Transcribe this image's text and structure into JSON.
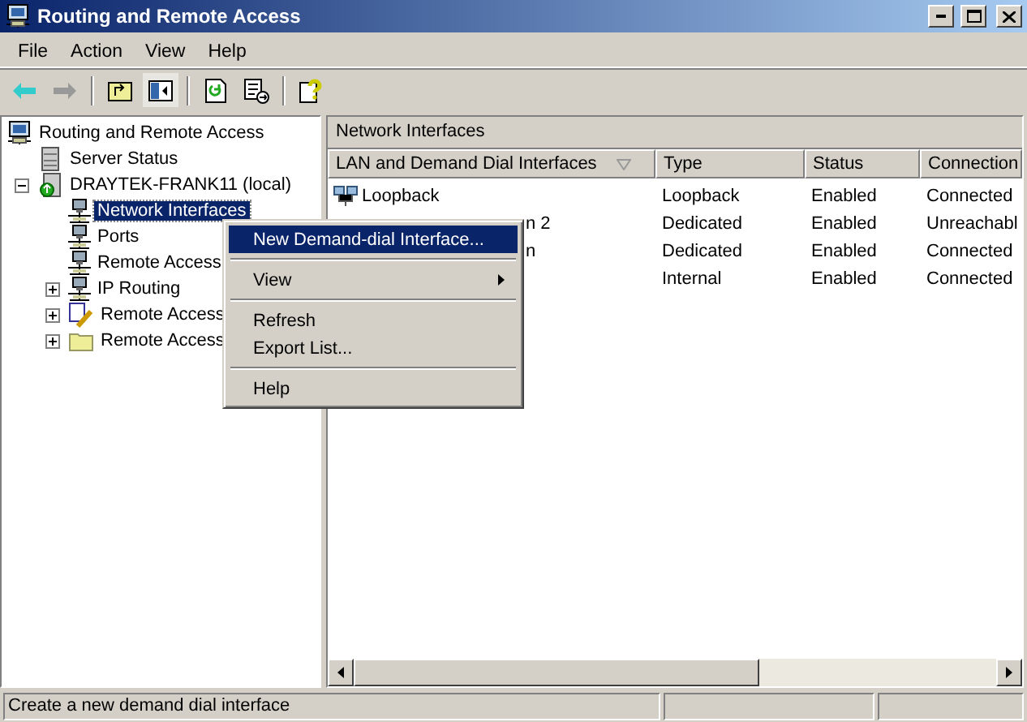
{
  "window": {
    "title": "Routing and Remote Access"
  },
  "menu_bar": [
    "File",
    "Action",
    "View",
    "Help"
  ],
  "toolbar": [
    {
      "kind": "back",
      "disabled": false
    },
    {
      "kind": "forward",
      "disabled": true
    },
    {
      "kind": "sep"
    },
    {
      "kind": "up"
    },
    {
      "kind": "tree",
      "selected": true
    },
    {
      "kind": "sep"
    },
    {
      "kind": "refresh"
    },
    {
      "kind": "export"
    },
    {
      "kind": "sep"
    },
    {
      "kind": "help"
    }
  ],
  "tree": [
    {
      "label": "Routing and Remote Access",
      "kind": "computer",
      "selected": false,
      "children": [
        {
          "label": "Server Status",
          "kind": "server",
          "selected": false
        },
        {
          "label": "DRAYTEK-FRANK11 (local)",
          "kind": "server-local",
          "selected": false,
          "expanded": true,
          "children": [
            {
              "label": "Network Interfaces",
              "kind": "network",
              "selected": true
            },
            {
              "label": "Ports",
              "kind": "network",
              "selected": false
            },
            {
              "label": "Remote Access",
              "kind": "network",
              "selected": false
            },
            {
              "label": "IP Routing",
              "kind": "network",
              "selected": false,
              "expanded": false
            },
            {
              "label": "Remote Access",
              "kind": "policy",
              "selected": false,
              "expanded": false
            },
            {
              "label": "Remote Access",
              "kind": "folder",
              "selected": false,
              "expanded": false
            }
          ]
        }
      ]
    }
  ],
  "pane": {
    "title": "Network Interfaces",
    "columns": [
      {
        "label": "LAN and Demand Dial Interfaces",
        "sorted": true
      },
      {
        "label": "Type"
      },
      {
        "label": "Status"
      },
      {
        "label": "Connection"
      }
    ],
    "rows": [
      {
        "kind": "full",
        "name": "Loopback",
        "type": "Loopback",
        "status": "Enabled",
        "connection": "Connected"
      },
      {
        "kind": "covered",
        "name": "n 2",
        "type": "Dedicated",
        "status": "Enabled",
        "connection": "Unreachabl"
      },
      {
        "kind": "covered",
        "name": "n",
        "type": "Dedicated",
        "status": "Enabled",
        "connection": "Connected"
      },
      {
        "kind": "hidden",
        "type": "Internal",
        "status": "Enabled",
        "connection": "Connected"
      }
    ]
  },
  "context_menu": [
    {
      "kind": "item",
      "label": "New Demand-dial Interface...",
      "selected": true
    },
    {
      "kind": "sep"
    },
    {
      "kind": "submenu",
      "label": "View",
      "selected": false
    },
    {
      "kind": "sep"
    },
    {
      "kind": "item",
      "label": "Refresh",
      "selected": false
    },
    {
      "kind": "item",
      "label": "Export List...",
      "selected": false
    },
    {
      "kind": "sep"
    },
    {
      "kind": "item",
      "label": "Help",
      "selected": false
    }
  ],
  "status_bar": "Create a new demand dial interface"
}
